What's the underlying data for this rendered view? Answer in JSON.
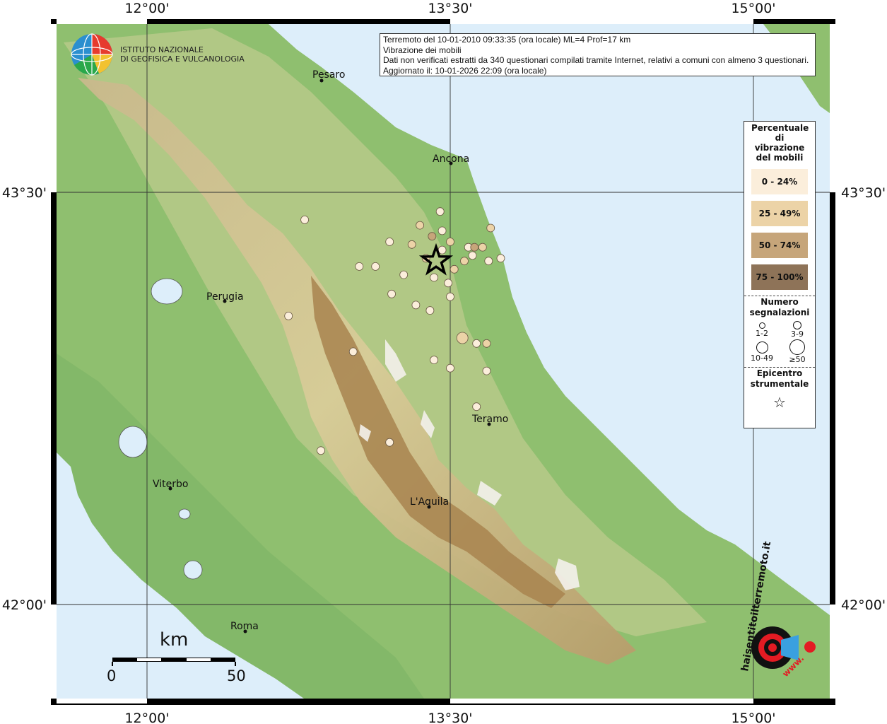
{
  "info": {
    "line1": "Terremoto del 10-01-2010 09:33:35 (ora locale) ML=4 Prof=17 km",
    "line2": "Vibrazione dei mobili",
    "line3": "Dati non verificati estratti da 340 questionari compilati tramite Internet, relativi a comuni con almeno 3 questionari.",
    "line4": "Aggiornato il: 10-01-2026 22:09 (ora locale)"
  },
  "logo": {
    "line1": "ISTITUTO NAZIONALE",
    "line2": "DI GEOFISICA E VULCANOLOGIA"
  },
  "axes": {
    "lon_ticks": [
      "12°00'",
      "13°30'",
      "15°00'"
    ],
    "lat_ticks": [
      "43°30'",
      "42°00'"
    ]
  },
  "cities": [
    {
      "name": "Pesaro"
    },
    {
      "name": "Ancona"
    },
    {
      "name": "Perugia"
    },
    {
      "name": "Teramo"
    },
    {
      "name": "Viterbo"
    },
    {
      "name": "L'Aquila"
    },
    {
      "name": "Roma"
    }
  ],
  "legend": {
    "title": "Percentuale di vibrazione del mobili",
    "classes": [
      {
        "label": "0 - 24%",
        "color": "#fbeedb"
      },
      {
        "label": "25 - 49%",
        "color": "#ecd3a7"
      },
      {
        "label": "50 - 74%",
        "color": "#c6a57a"
      },
      {
        "label": "75 - 100%",
        "color": "#8e7358"
      }
    ],
    "count_title": "Numero segnalazioni",
    "counts": [
      "1-2",
      "3-9",
      "10-49",
      "≥50"
    ],
    "epicenter_title": "Epicentro strumentale"
  },
  "scale": {
    "unit": "km",
    "start": "0",
    "end": "50"
  },
  "watermark": {
    "text": "haisentitoilterremoto.it",
    "url": "www."
  },
  "chart_data": {
    "type": "scatter",
    "title": "Vibrazione dei mobili",
    "epicenter": {
      "lon": 13.43,
      "lat": 43.25
    },
    "points": [
      {
        "lon": 13.45,
        "lat": 43.43,
        "class": 0,
        "count": "3-9"
      },
      {
        "lon": 12.78,
        "lat": 43.4,
        "class": 0,
        "count": "3-9"
      },
      {
        "lon": 13.35,
        "lat": 43.38,
        "class": 1,
        "count": "3-9"
      },
      {
        "lon": 13.46,
        "lat": 43.36,
        "class": 0,
        "count": "3-9"
      },
      {
        "lon": 13.7,
        "lat": 43.37,
        "class": 1,
        "count": "3-9"
      },
      {
        "lon": 13.41,
        "lat": 43.34,
        "class": 2,
        "count": "3-9"
      },
      {
        "lon": 13.2,
        "lat": 43.32,
        "class": 0,
        "count": "3-9"
      },
      {
        "lon": 13.31,
        "lat": 43.31,
        "class": 1,
        "count": "3-9"
      },
      {
        "lon": 13.5,
        "lat": 43.32,
        "class": 1,
        "count": "3-9"
      },
      {
        "lon": 13.59,
        "lat": 43.3,
        "class": 0,
        "count": "3-9"
      },
      {
        "lon": 13.62,
        "lat": 43.3,
        "class": 2,
        "count": "3-9"
      },
      {
        "lon": 13.66,
        "lat": 43.3,
        "class": 1,
        "count": "3-9"
      },
      {
        "lon": 13.46,
        "lat": 43.29,
        "class": 0,
        "count": "3-9"
      },
      {
        "lon": 13.38,
        "lat": 43.26,
        "class": 1,
        "count": "3-9"
      },
      {
        "lon": 13.61,
        "lat": 43.27,
        "class": 0,
        "count": "3-9"
      },
      {
        "lon": 13.57,
        "lat": 43.25,
        "class": 1,
        "count": "3-9"
      },
      {
        "lon": 13.69,
        "lat": 43.25,
        "class": 0,
        "count": "3-9"
      },
      {
        "lon": 13.75,
        "lat": 43.26,
        "class": 0,
        "count": "3-9"
      },
      {
        "lon": 13.05,
        "lat": 43.23,
        "class": 0,
        "count": "3-9"
      },
      {
        "lon": 13.13,
        "lat": 43.23,
        "class": 0,
        "count": "3-9"
      },
      {
        "lon": 13.52,
        "lat": 43.22,
        "class": 1,
        "count": "3-9"
      },
      {
        "lon": 13.27,
        "lat": 43.2,
        "class": 0,
        "count": "3-9"
      },
      {
        "lon": 13.42,
        "lat": 43.19,
        "class": 0,
        "count": "3-9"
      },
      {
        "lon": 13.49,
        "lat": 43.17,
        "class": 0,
        "count": "3-9"
      },
      {
        "lon": 13.21,
        "lat": 43.13,
        "class": 0,
        "count": "3-9"
      },
      {
        "lon": 13.5,
        "lat": 43.12,
        "class": 0,
        "count": "3-9"
      },
      {
        "lon": 13.33,
        "lat": 43.09,
        "class": 0,
        "count": "3-9"
      },
      {
        "lon": 13.4,
        "lat": 43.07,
        "class": 0,
        "count": "3-9"
      },
      {
        "lon": 12.7,
        "lat": 43.05,
        "class": 0,
        "count": "3-9"
      },
      {
        "lon": 13.56,
        "lat": 42.97,
        "class": 1,
        "count": "10-49"
      },
      {
        "lon": 13.63,
        "lat": 42.95,
        "class": 0,
        "count": "3-9"
      },
      {
        "lon": 13.68,
        "lat": 42.95,
        "class": 1,
        "count": "3-9"
      },
      {
        "lon": 13.02,
        "lat": 42.92,
        "class": 0,
        "count": "3-9"
      },
      {
        "lon": 13.42,
        "lat": 42.89,
        "class": 0,
        "count": "3-9"
      },
      {
        "lon": 13.5,
        "lat": 42.86,
        "class": 0,
        "count": "3-9"
      },
      {
        "lon": 13.68,
        "lat": 42.85,
        "class": 0,
        "count": "3-9"
      },
      {
        "lon": 13.63,
        "lat": 42.72,
        "class": 0,
        "count": "3-9"
      },
      {
        "lon": 13.2,
        "lat": 42.59,
        "class": 0,
        "count": "3-9"
      },
      {
        "lon": 12.86,
        "lat": 42.56,
        "class": 0,
        "count": "3-9"
      }
    ]
  }
}
